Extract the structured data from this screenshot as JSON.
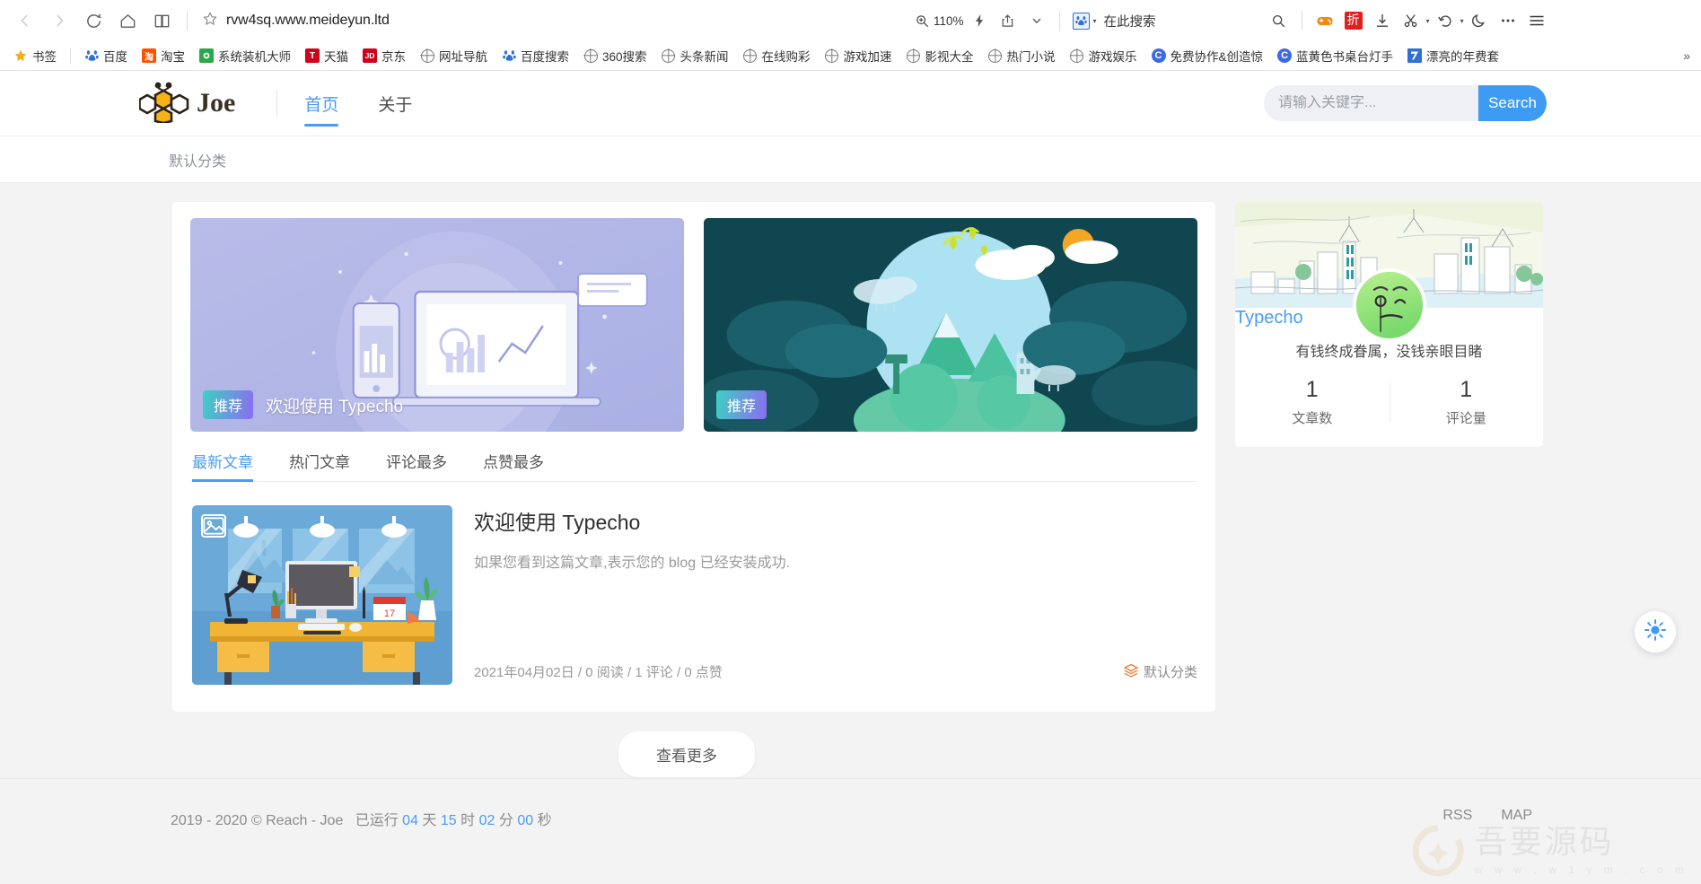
{
  "browser": {
    "back_label": "back",
    "forward_label": "forward",
    "reload_label": "reload",
    "home_label": "home",
    "reading_label": "reading-list",
    "bookmark_star_label": "bookmark",
    "url": "rvw4sq.www.meideyun.ltd",
    "zoom_level": "110%",
    "search_engine": "baidu",
    "search_placeholder": "在此搜索",
    "toolbar_icons": [
      "lightning",
      "share",
      "chevron-down",
      "search",
      "gamepad",
      "discount",
      "download",
      "cut",
      "history",
      "night-mode",
      "more",
      "menu"
    ],
    "discount_label": "折"
  },
  "bookmarks": {
    "star_label": "书签",
    "items": [
      {
        "label": "百度",
        "icon": "baidu"
      },
      {
        "label": "淘宝",
        "icon": "taobao"
      },
      {
        "label": "系统装机大师",
        "icon": "green-flower"
      },
      {
        "label": "天猫",
        "icon": "tmall"
      },
      {
        "label": "京东",
        "icon": "jd"
      },
      {
        "label": "网址导航",
        "icon": "globe"
      },
      {
        "label": "百度搜索",
        "icon": "baidu"
      },
      {
        "label": "360搜索",
        "icon": "globe"
      },
      {
        "label": "头条新闻",
        "icon": "globe"
      },
      {
        "label": "在线购彩",
        "icon": "globe"
      },
      {
        "label": "游戏加速",
        "icon": "globe"
      },
      {
        "label": "影视大全",
        "icon": "globe"
      },
      {
        "label": "热门小说",
        "icon": "globe"
      },
      {
        "label": "游戏娱乐",
        "icon": "globe"
      },
      {
        "label": "免费协作&创造惊",
        "icon": "c-blue"
      },
      {
        "label": "蓝黄色书桌台灯手",
        "icon": "c-blue"
      },
      {
        "label": "漂亮的年费套",
        "icon": "blue-square"
      }
    ],
    "overflow_label": "»"
  },
  "site": {
    "brand_name": "Joe",
    "brand_logo": "bee-logo",
    "nav": [
      {
        "label": "首页",
        "active": true
      },
      {
        "label": "关于",
        "active": false
      }
    ],
    "search": {
      "placeholder": "请输入关键字...",
      "value": "",
      "button_label": "Search"
    },
    "subnav_label": "默认分类"
  },
  "featured": [
    {
      "badge": "推荐",
      "title": "欢迎使用 Typecho",
      "image": "laptop-phone-illustration"
    },
    {
      "badge": "推荐",
      "title": "",
      "image": "nature-globe-illustration"
    }
  ],
  "tabs": [
    {
      "label": "最新文章",
      "active": true
    },
    {
      "label": "热门文章",
      "active": false
    },
    {
      "label": "评论最多",
      "active": false
    },
    {
      "label": "点赞最多",
      "active": false
    }
  ],
  "article": {
    "thumb": "desk-workspace-illustration",
    "title": "欢迎使用 Typecho",
    "desc": "如果您看到这篇文章,表示您的 blog 已经安装成功.",
    "date": "2021年04月02日",
    "sep": "/",
    "reads": "0 阅读",
    "comments": "1 评论",
    "likes": "0 点赞",
    "category": "默认分类"
  },
  "more_button_label": "查看更多",
  "profile": {
    "banner": "city-skyline-illustration",
    "avatar": "green-face-avatar",
    "name": "Typecho",
    "motto": "有钱终成眷属，没钱亲眼目睹",
    "stats": [
      {
        "value": "1",
        "label": "文章数"
      },
      {
        "value": "1",
        "label": "评论量"
      }
    ]
  },
  "footer": {
    "copyright": "2019 - 2020 © Reach - Joe",
    "uptime_prefix": "已运行",
    "days": "04",
    "days_unit": "天",
    "hours": "15",
    "hours_unit": "时",
    "minutes": "02",
    "minutes_unit": "分",
    "seconds": "00",
    "seconds_unit": "秒",
    "links": [
      {
        "label": "RSS"
      },
      {
        "label": "MAP"
      }
    ]
  },
  "fab": {
    "icon": "sun-icon",
    "label": "theme-toggle"
  },
  "watermark": {
    "text": "吾要源码",
    "sub": "w w w . w 1 y m . c o m"
  },
  "colors": {
    "accent": "#4a9bf5",
    "search_button": "#3e9bf4",
    "badge_from": "#3ed0c2",
    "badge_to": "#8b6cf0",
    "page_bg": "#f3f3f3"
  }
}
